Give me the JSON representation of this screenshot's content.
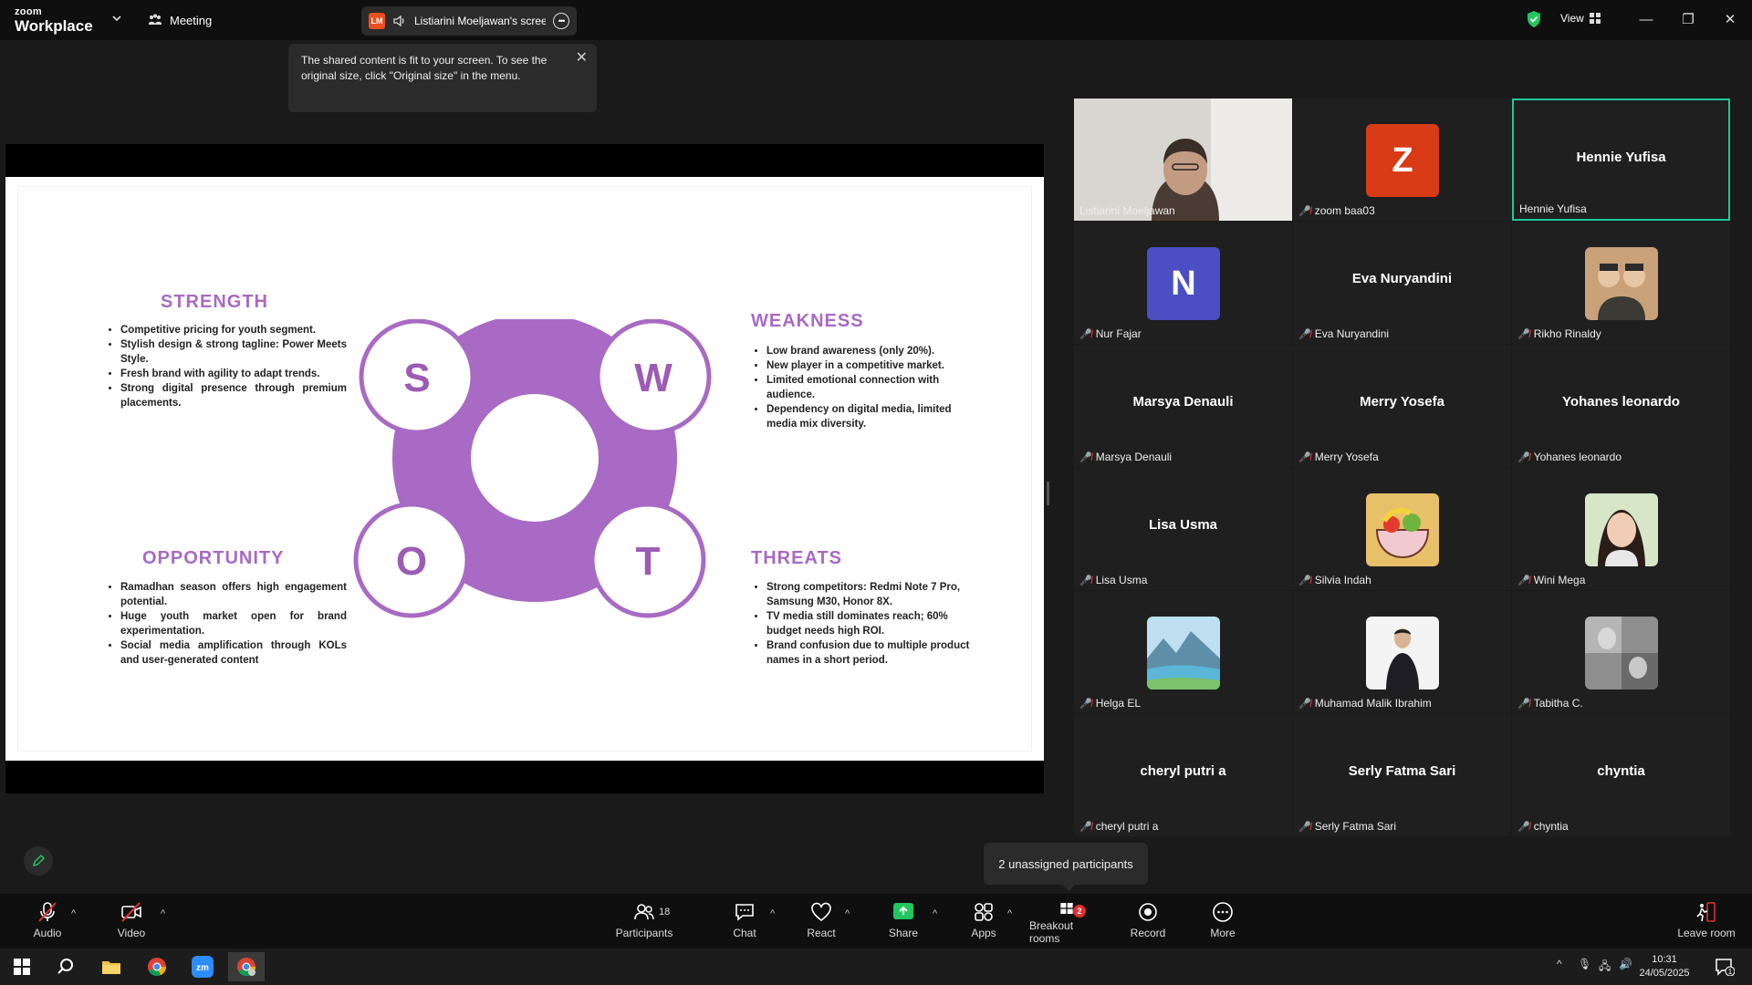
{
  "topbar": {
    "brand_small": "zoom",
    "brand_large": "Workplace",
    "meeting_label": "Meeting",
    "sharer_initials": "LM",
    "sharer_label": "Listiarini Moeljawan's screen",
    "view_label": "View"
  },
  "tooltip": {
    "text": "The shared content is fit to your screen. To see the original size, click \"Original size\" in the menu."
  },
  "slide": {
    "strength": {
      "title": "STRENGTH",
      "items": [
        "Competitive pricing for youth segment.",
        "Stylish design & strong tagline: Power Meets Style.",
        "Fresh brand with agility to adapt trends.",
        "Strong digital presence through premium placements."
      ]
    },
    "weakness": {
      "title": "WEAKNESS",
      "items": [
        "Low brand awareness (only 20%).",
        "New player in a competitive market.",
        "Limited emotional connection with audience.",
        "Dependency on digital media, limited media mix diversity."
      ]
    },
    "opportunity": {
      "title": "OPPORTUNITY",
      "items": [
        "Ramadhan season offers high engagement potential.",
        "Huge youth market open for brand experimentation.",
        "Social media amplification through KOLs and user-generated content"
      ]
    },
    "threats": {
      "title": "THREATS",
      "items": [
        "Strong competitors: Redmi Note 7 Pro, Samsung M30, Honor 8X.",
        "TV media still dominates reach; 60% budget needs high ROI.",
        "Brand confusion due to multiple product names in a short period."
      ]
    },
    "letters": {
      "s": "S",
      "w": "W",
      "o": "O",
      "t": "T"
    },
    "accent": "#9c5bb5"
  },
  "participants": [
    {
      "name": "Listiarini Moeljawan",
      "kind": "video",
      "muted": false
    },
    {
      "name": "zoom baa03",
      "kind": "avatar",
      "initial": "Z",
      "color": "#d83b16",
      "muted": true
    },
    {
      "name": "Hennie Yufisa",
      "kind": "name",
      "muted": false,
      "active": true
    },
    {
      "name": "Nur Fajar",
      "kind": "avatar",
      "initial": "N",
      "color": "#4b4fc3",
      "muted": true
    },
    {
      "name": "Eva Nuryandini",
      "kind": "name",
      "muted": true
    },
    {
      "name": "Rikho Rinaldy",
      "kind": "photo",
      "muted": true
    },
    {
      "name": "Marsya Denauli",
      "kind": "name",
      "muted": true
    },
    {
      "name": "Merry Yosefa",
      "kind": "name",
      "muted": true
    },
    {
      "name": "Yohanes leonardo",
      "kind": "name",
      "muted": true
    },
    {
      "name": "Lisa Usma",
      "kind": "name",
      "muted": true
    },
    {
      "name": "Silvia Indah",
      "kind": "photo",
      "muted": true
    },
    {
      "name": "Wini Mega",
      "kind": "photo",
      "muted": true
    },
    {
      "name": "Helga EL",
      "kind": "photo",
      "muted": true
    },
    {
      "name": "Muhamad Malik Ibrahim",
      "kind": "photo",
      "muted": true
    },
    {
      "name": "Tabitha C.",
      "kind": "photo",
      "muted": true
    },
    {
      "name": "cheryl putri a",
      "kind": "name",
      "muted": true
    },
    {
      "name": "Serly Fatma Sari",
      "kind": "name",
      "muted": true
    },
    {
      "name": "chyntia",
      "kind": "name",
      "muted": true
    }
  ],
  "unassigned_tooltip": "2 unassigned participants",
  "toolbar": {
    "audio": "Audio",
    "video": "Video",
    "participants": "Participants",
    "participants_count": "18",
    "chat": "Chat",
    "react": "React",
    "share": "Share",
    "apps": "Apps",
    "breakout": "Breakout rooms",
    "breakout_badge": "2",
    "record": "Record",
    "more": "More",
    "leave": "Leave room"
  },
  "taskbar": {
    "time": "10:31",
    "date": "24/05/2025",
    "notif_count": "1"
  },
  "colors": {
    "active_border": "#20c997",
    "share_green": "#22c55e",
    "muted_red": "#e02f2f"
  }
}
